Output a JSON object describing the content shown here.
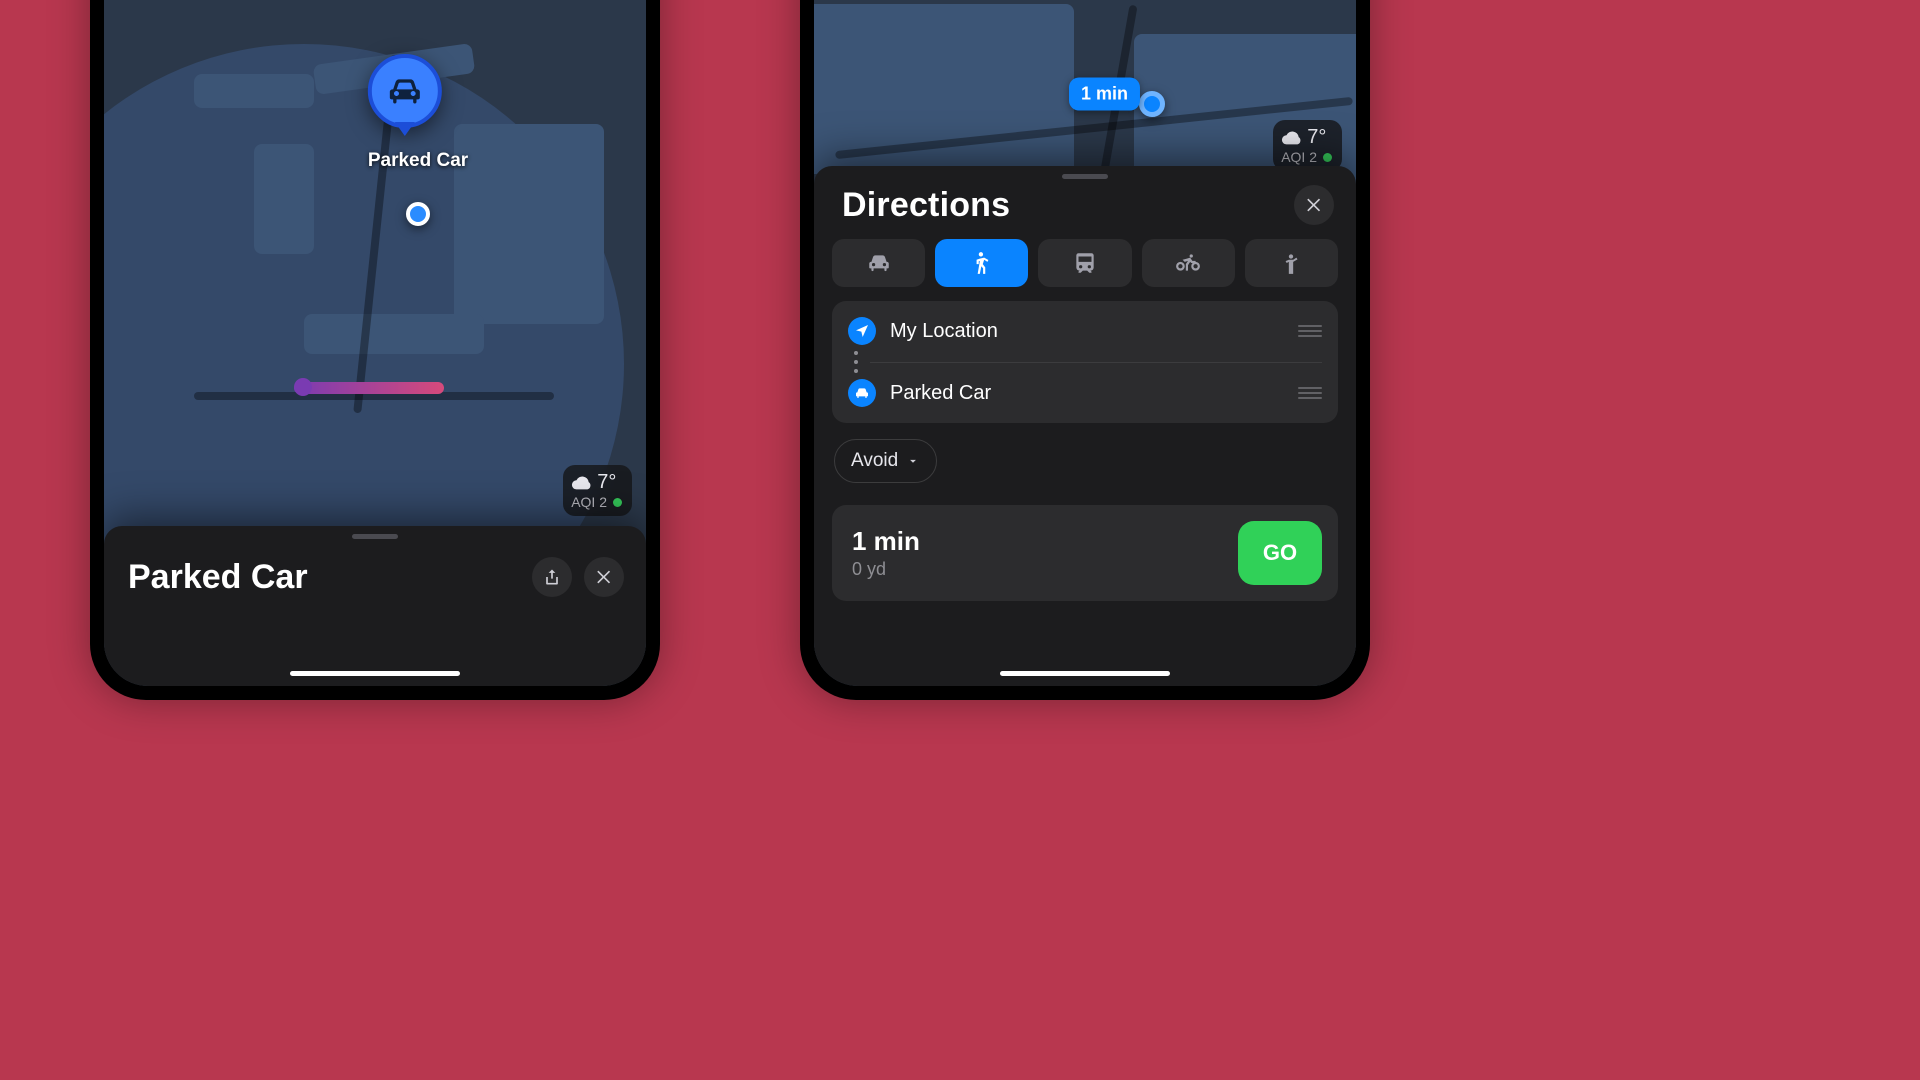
{
  "weather": {
    "temp": "7°",
    "aqi_label": "AQI 2"
  },
  "left": {
    "pin_label": "Parked Car",
    "sheet_title": "Parked Car"
  },
  "right": {
    "eta_pill": "1 min",
    "title": "Directions",
    "from_label": "My Location",
    "to_label": "Parked Car",
    "avoid_label": "Avoid",
    "result_time": "1 min",
    "result_dist": "0 yd",
    "go_label": "GO"
  }
}
